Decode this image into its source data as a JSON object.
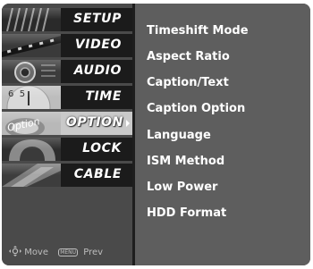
{
  "sidebar": {
    "items": [
      {
        "label": "SETUP"
      },
      {
        "label": "VIDEO"
      },
      {
        "label": "AUDIO"
      },
      {
        "label": "TIME"
      },
      {
        "label": "OPTION"
      },
      {
        "label": "LOCK"
      },
      {
        "label": "CABLE"
      }
    ],
    "selected": "OPTION"
  },
  "thumbnail_text": {
    "time_clock_digits": "6  5",
    "option_overlay": "Option"
  },
  "footer": {
    "move_label": "Move",
    "menu_badge": "MENU",
    "prev_label": "Prev"
  },
  "options": {
    "items": [
      {
        "label": "Timeshift Mode"
      },
      {
        "label": "Aspect Ratio"
      },
      {
        "label": "Caption/Text"
      },
      {
        "label": "Caption Option"
      },
      {
        "label": "Language"
      },
      {
        "label": "ISM Method"
      },
      {
        "label": "Low Power"
      },
      {
        "label": "HDD Format"
      }
    ]
  }
}
